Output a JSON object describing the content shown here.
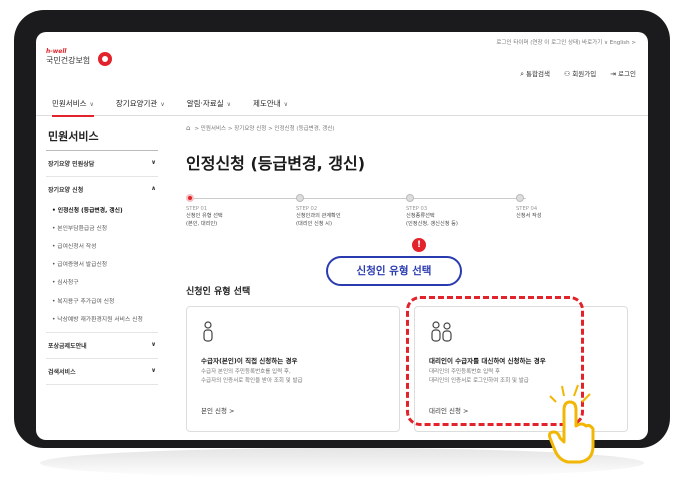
{
  "topbar": {
    "text": "로그인 타이머 (연장 이 로그인 상태) 바로가기 ∨    English >"
  },
  "logo": {
    "brand_en": "h-well",
    "brand_ko": "국민건강보험"
  },
  "util": {
    "search": "통합검색",
    "join": "회원가입",
    "login": "로그인"
  },
  "gnb": {
    "items": [
      {
        "label": "민원서비스"
      },
      {
        "label": "장기요양기관"
      },
      {
        "label": "알림·자료실"
      },
      {
        "label": "제도안내"
      }
    ]
  },
  "sidebar": {
    "title": "민원서비스",
    "sections": [
      {
        "label": "장기요양 민원상담",
        "chev": "∨"
      },
      {
        "label": "장기요양 신청",
        "chev": "∧"
      }
    ],
    "subitems": [
      {
        "label": "인정신청 (등급변경, 갱신)"
      },
      {
        "label": "본인부담환급금 신청"
      },
      {
        "label": "급여신청서 작성"
      },
      {
        "label": "급여증명서 발급신청"
      },
      {
        "label": "심사청구"
      },
      {
        "label": "복지용구 추가급여 신청"
      },
      {
        "label": "낙상예방 재가환경지원 서비스 신청"
      }
    ],
    "bottom_sections": [
      {
        "label": "포상금제도안내",
        "chev": "∨"
      },
      {
        "label": "검색서비스",
        "chev": "∨"
      }
    ]
  },
  "main": {
    "breadcrumb": "> 민원서비스 > 장기요양 신청 > 인정신청 (등급변경, 갱신)",
    "page_title": "인정신청 (등급변경, 갱신)",
    "steps": [
      {
        "num": "STEP 01",
        "label1": "신청인 유형 선택",
        "label2": "(본인, 대리인)"
      },
      {
        "num": "STEP 02",
        "label1": "신청인과의 관계확인",
        "label2": "(대리인 신청 시)"
      },
      {
        "num": "STEP 03",
        "label1": "신청종류선택",
        "label2": "(인정신청, 갱신신청 등)"
      },
      {
        "num": "STEP 04",
        "label1": "신청서 작성",
        "label2": ""
      }
    ],
    "alert_mark": "!",
    "callout": "신청인 유형 선택",
    "section_title": "신청인 유형 선택",
    "cards": [
      {
        "title": "수급자(본인)이 직접 신청하는 경우",
        "desc1": "수급자 본인의 주민등록번호를 입력 후,",
        "desc2": "수급자의 인증서로 확인을 받아 조회 및 발급",
        "link": "본인 신청  >"
      },
      {
        "title": "대리인이 수급자를 대신하여 신청하는 경우",
        "desc1": "대리인의 주민등록번호 입력 후",
        "desc2": "대리인의 인증서로 로그인하여 조회 및 발급",
        "link": "대리인 신청  >"
      }
    ]
  },
  "colors": {
    "brand_red": "#e2232b",
    "callout_blue": "#2a3bb0",
    "hand_yellow": "#f2b705"
  }
}
